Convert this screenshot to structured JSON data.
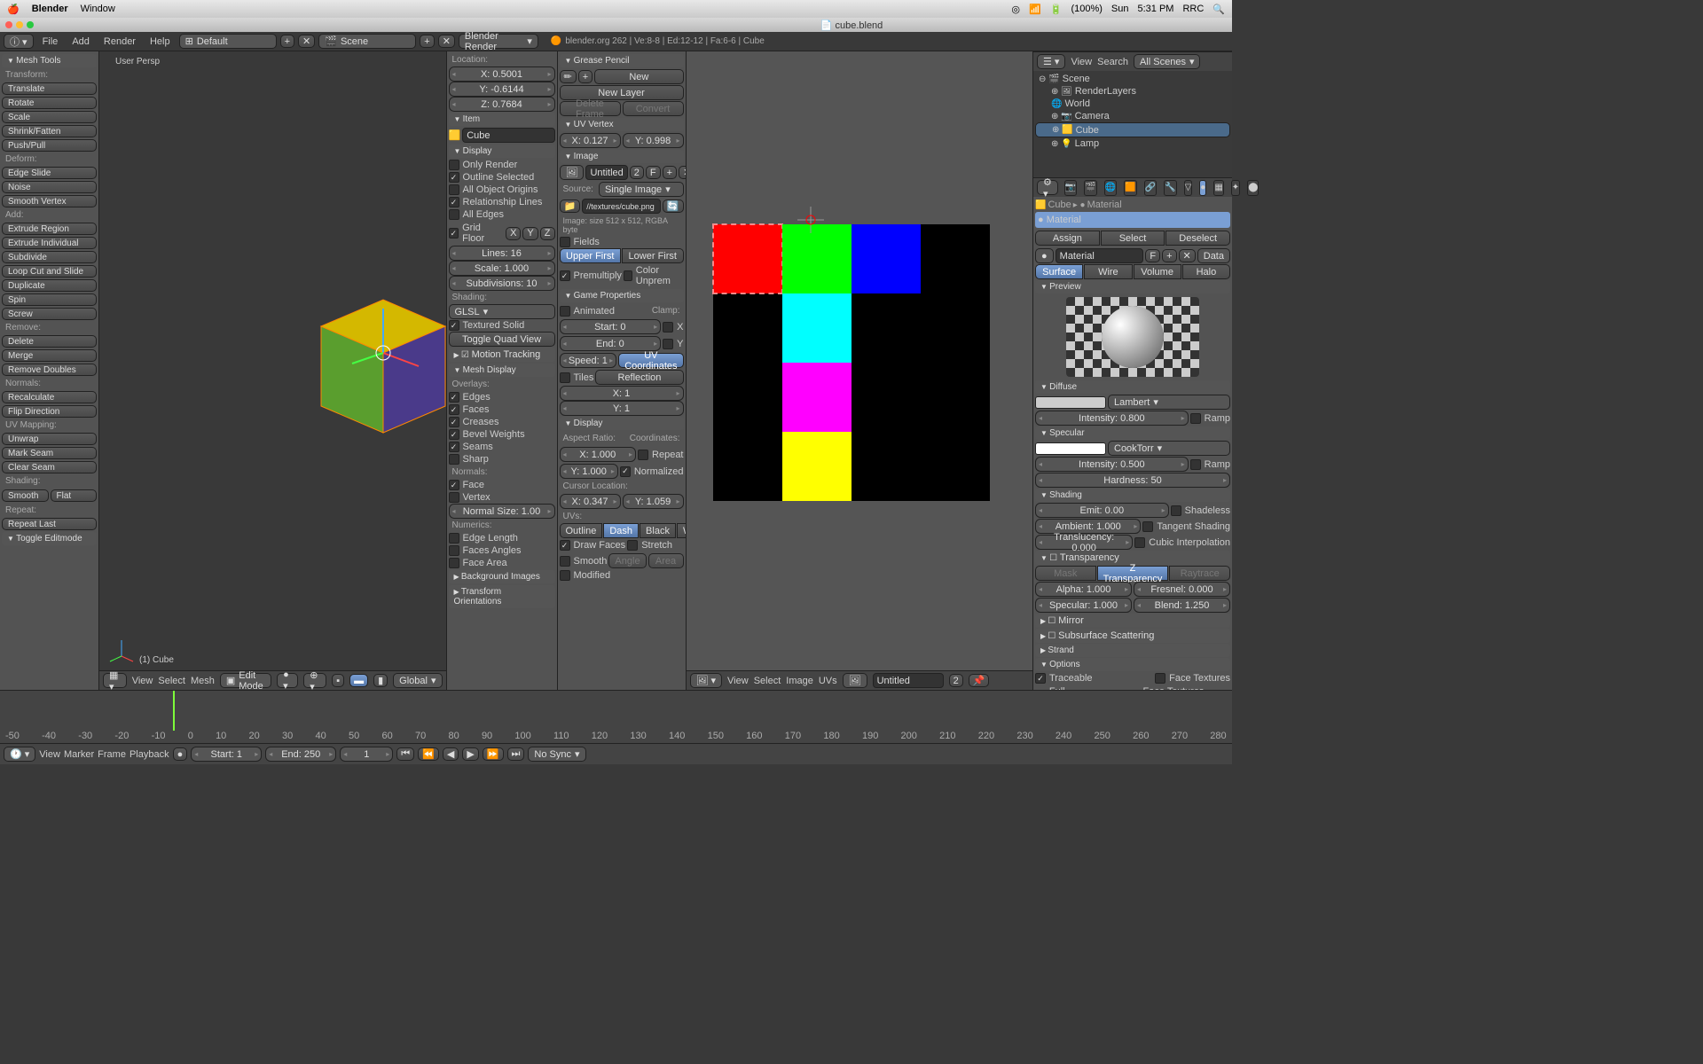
{
  "mac": {
    "app": "Blender",
    "menu": "Window",
    "battery": "(100%)",
    "day": "Sun",
    "time": "5:31 PM",
    "user": "RRC"
  },
  "title": "cube.blend",
  "topmenu": [
    "File",
    "Add",
    "Render",
    "Help"
  ],
  "layout": "Default",
  "scene": "Scene",
  "renderer": "Blender Render",
  "info": "blender.org 262 | Ve:8-8 | Ed:12-12 | Fa:6-6 | Cube",
  "tools": {
    "hdr": "Mesh Tools",
    "transform": [
      "Translate",
      "Rotate",
      "Scale",
      "Shrink/Fatten",
      "Push/Pull"
    ],
    "deform": [
      "Edge Slide",
      "Noise",
      "Smooth Vertex"
    ],
    "add": [
      "Extrude Region",
      "Extrude Individual",
      "Subdivide",
      "Loop Cut and Slide",
      "Duplicate",
      "Spin",
      "Screw"
    ],
    "remove": [
      "Delete",
      "Merge",
      "Remove Doubles"
    ],
    "normals": [
      "Recalculate",
      "Flip Direction"
    ],
    "uvmap": [
      "Unwrap",
      "Mark Seam",
      "Clear Seam"
    ],
    "shading": [
      "Smooth",
      "Flat"
    ],
    "repeat": "Repeat:",
    "repeatlast": "Repeat Last",
    "toggle": "Toggle Editmode"
  },
  "vp": {
    "persp": "User Persp",
    "obj": "(1) Cube",
    "mode": "Edit Mode",
    "orient": "Global",
    "menu": [
      "View",
      "Select",
      "Mesh"
    ]
  },
  "n": {
    "loc": {
      "hdr": "Location:",
      "x": "X: 0.5001",
      "y": "Y: -0.6144",
      "z": "Z: 0.7684"
    },
    "item": {
      "hdr": "Item",
      "name": "Cube"
    },
    "display": {
      "hdr": "Display",
      "only": "Only Render",
      "outline": "Outline Selected",
      "origins": "All Object Origins",
      "rel": "Relationship Lines",
      "edges": "All Edges",
      "grid": "Grid Floor",
      "xyz": [
        "X",
        "Y",
        "Z"
      ],
      "lines": "Lines: 16",
      "scale": "Scale: 1.000",
      "subdiv": "Subdivisions: 10"
    },
    "shading": {
      "hdr": "Shading:",
      "mode": "GLSL",
      "tex": "Textured Solid",
      "toggle": "Toggle Quad View"
    },
    "motion": "Motion Tracking",
    "mesh": {
      "hdr": "Mesh Display",
      "overlays": "Overlays:",
      "edges": "Edges",
      "faces": "Faces",
      "creases": "Creases",
      "bevel": "Bevel Weights",
      "seams": "Seams",
      "sharp": "Sharp",
      "normals": "Normals:",
      "face": "Face",
      "vertex": "Vertex",
      "nsize": "Normal Size: 1.00",
      "numerics": "Numerics:",
      "elen": "Edge Length",
      "fangle": "Faces Angles",
      "farea": "Face Area"
    },
    "bg": "Background Images",
    "to": "Transform Orientations"
  },
  "uv": {
    "gp": {
      "hdr": "Grease Pencil",
      "new": "New",
      "layer": "New Layer",
      "delf": "Delete Frame",
      "conv": "Convert"
    },
    "uvv": {
      "hdr": "UV Vertex",
      "x": "X: 0.127",
      "y": "Y: 0.998"
    },
    "img": {
      "hdr": "Image",
      "name": "Untitled",
      "two": "2",
      "src": "Source:",
      "srcv": "Single Image",
      "path": "//textures/cube.png",
      "info": "Image: size 512 x 512, RGBA byte",
      "fields": "Fields",
      "upper": "Upper First",
      "lower": "Lower First",
      "premul": "Premultiply",
      "unprem": "Color Unprem"
    },
    "game": {
      "hdr": "Game Properties",
      "anim": "Animated",
      "clamp": "Clamp:",
      "start": "Start: 0",
      "end": "End: 0",
      "speed": "Speed: 1",
      "x": "X",
      "y": "Y",
      "tiles": "Tiles",
      "tx": "X: 1",
      "ty": "Y: 1",
      "uvc": "UV Coordinates",
      "refl": "Reflection"
    },
    "disp": {
      "hdr": "Display",
      "ar": "Aspect Ratio:",
      "x": "X: 1.000",
      "y": "Y: 1.000",
      "coord": "Coordinates:",
      "repeat": "Repeat",
      "norm": "Normalized",
      "cursor": "Cursor Location:",
      "cx": "X: 0.347",
      "cy": "Y: 1.059",
      "uvs": "UVs:",
      "outline": "Outline",
      "dash": "Dash",
      "black": "Black",
      "white": "White",
      "draw": "Draw Faces",
      "stretch": "Stretch",
      "smooth": "Smooth",
      "angle": "Angle",
      "area": "Area",
      "mod": "Modified"
    },
    "menu": [
      "View",
      "Select",
      "Image",
      "UVs"
    ],
    "imgname": "Untitled",
    "imgidx": "2"
  },
  "ol": {
    "menu": [
      "View",
      "Search"
    ],
    "filter": "All Scenes",
    "items": [
      "Scene",
      "RenderLayers",
      "World",
      "Camera",
      "Cube",
      "Lamp"
    ]
  },
  "props": {
    "crumb": [
      "Cube",
      "Material"
    ],
    "mat": "Material",
    "assign": "Assign",
    "select": "Select",
    "deselect": "Deselect",
    "matname": "Material",
    "data": "Data",
    "tabs": [
      "Surface",
      "Wire",
      "Volume",
      "Halo"
    ],
    "preview": "Preview",
    "diffuse": {
      "hdr": "Diffuse",
      "shader": "Lambert",
      "intensity": "Intensity: 0.800",
      "ramp": "Ramp"
    },
    "spec": {
      "hdr": "Specular",
      "shader": "CookTorr",
      "intensity": "Intensity: 0.500",
      "ramp": "Ramp",
      "hard": "Hardness: 50"
    },
    "shd": {
      "hdr": "Shading",
      "emit": "Emit: 0.00",
      "shadeless": "Shadeless",
      "ambient": "Ambient: 1.000",
      "tangent": "Tangent Shading",
      "trans": "Translucency: 0.000",
      "cubic": "Cubic Interpolation"
    },
    "transp": {
      "hdr": "Transparency",
      "mask": "Mask",
      "z": "Z Transparency",
      "ray": "Raytrace",
      "alpha": "Alpha: 1.000",
      "fresnel": "Fresnel: 0.000",
      "specular": "Specular: 1.000",
      "blend": "Blend: 1.250"
    },
    "mirror": "Mirror",
    "sss": "Subsurface Scattering",
    "strand": "Strand",
    "options": "Options",
    "trace": "Traceable",
    "facetex": "Face Textures",
    "fullover": "Full Oversampling",
    "facetexa": "Face Textures Alpha"
  },
  "tl": {
    "menu": [
      "View",
      "Marker",
      "Frame",
      "Playback"
    ],
    "start": "Start: 1",
    "end": "End: 250",
    "cur": "1",
    "sync": "No Sync",
    "ticks": [
      "-50",
      "-40",
      "-30",
      "-20",
      "-10",
      "0",
      "10",
      "20",
      "30",
      "40",
      "50",
      "60",
      "70",
      "80",
      "90",
      "100",
      "110",
      "120",
      "130",
      "140",
      "150",
      "160",
      "170",
      "180",
      "190",
      "200",
      "210",
      "220",
      "230",
      "240",
      "250",
      "260",
      "270",
      "280"
    ]
  }
}
